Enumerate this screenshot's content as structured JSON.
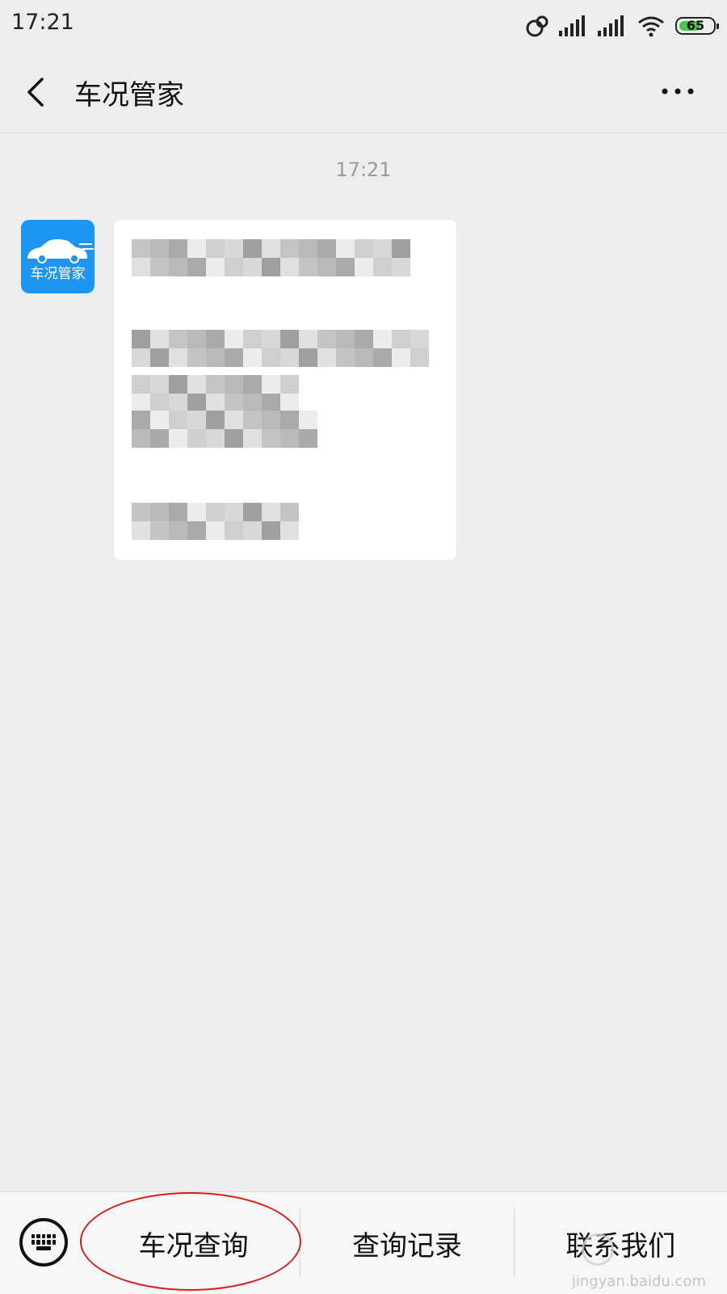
{
  "status_bar": {
    "time": "17:21",
    "battery": "65",
    "battery_level_percent": 65,
    "icons": [
      "link-icon",
      "signal-icon",
      "signal-icon",
      "wifi-icon",
      "battery-icon"
    ]
  },
  "header": {
    "title": "车况管家",
    "back_icon": "chevron-left-icon",
    "more_icon": "more-icon"
  },
  "chat": {
    "time": "17:21",
    "sender_avatar_label": "车况管家",
    "message_content": "pixelated-obscured"
  },
  "bottom_menu": {
    "items": [
      {
        "label": "车况查询"
      },
      {
        "label": "查询记录"
      },
      {
        "label": "联系我们"
      }
    ],
    "keyboard_icon": "keyboard-icon"
  },
  "watermark": {
    "text": "jingyan.baidu.com"
  },
  "colors": {
    "background": "#ededed",
    "avatar": "#1e96f0",
    "annotation": "#d0201b",
    "battery_fill": "#49c94b"
  }
}
